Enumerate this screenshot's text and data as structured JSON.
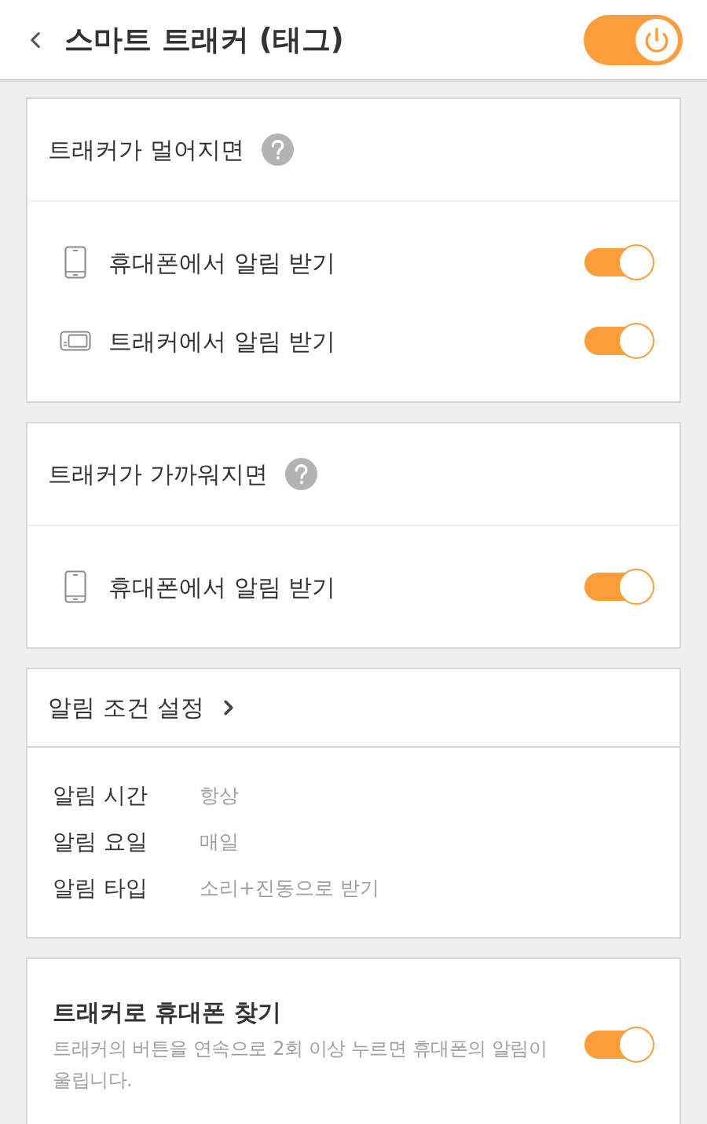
{
  "header": {
    "title": "스마트 트래커 (태그)",
    "power_on": true
  },
  "sections": [
    {
      "kind": "toggles",
      "title": "트래커가 멀어지면",
      "items": [
        {
          "kind": "phone",
          "label": "휴대폰에서 알림 받기",
          "on": true
        },
        {
          "kind": "tracker",
          "label": "트래커에서 알림 받기",
          "on": true
        }
      ]
    },
    {
      "kind": "toggles",
      "title": "트래커가 가까워지면",
      "items": [
        {
          "kind": "phone",
          "label": "휴대폰에서 알림 받기",
          "on": true
        }
      ]
    },
    {
      "kind": "conditions",
      "title": "알림 조건 설정",
      "rows": [
        {
          "label": "알림 시간",
          "value": "항상"
        },
        {
          "label": "알림 요일",
          "value": "매일"
        },
        {
          "label": "알림 타입",
          "value": "소리+진동으로 받기"
        }
      ]
    },
    {
      "kind": "feature",
      "title": "트래커로 휴대폰 찾기",
      "description": "트래커의 버튼을 연속으로 2회 이상 누르면 휴대폰의 알림이 울립니다.",
      "on": true
    }
  ]
}
